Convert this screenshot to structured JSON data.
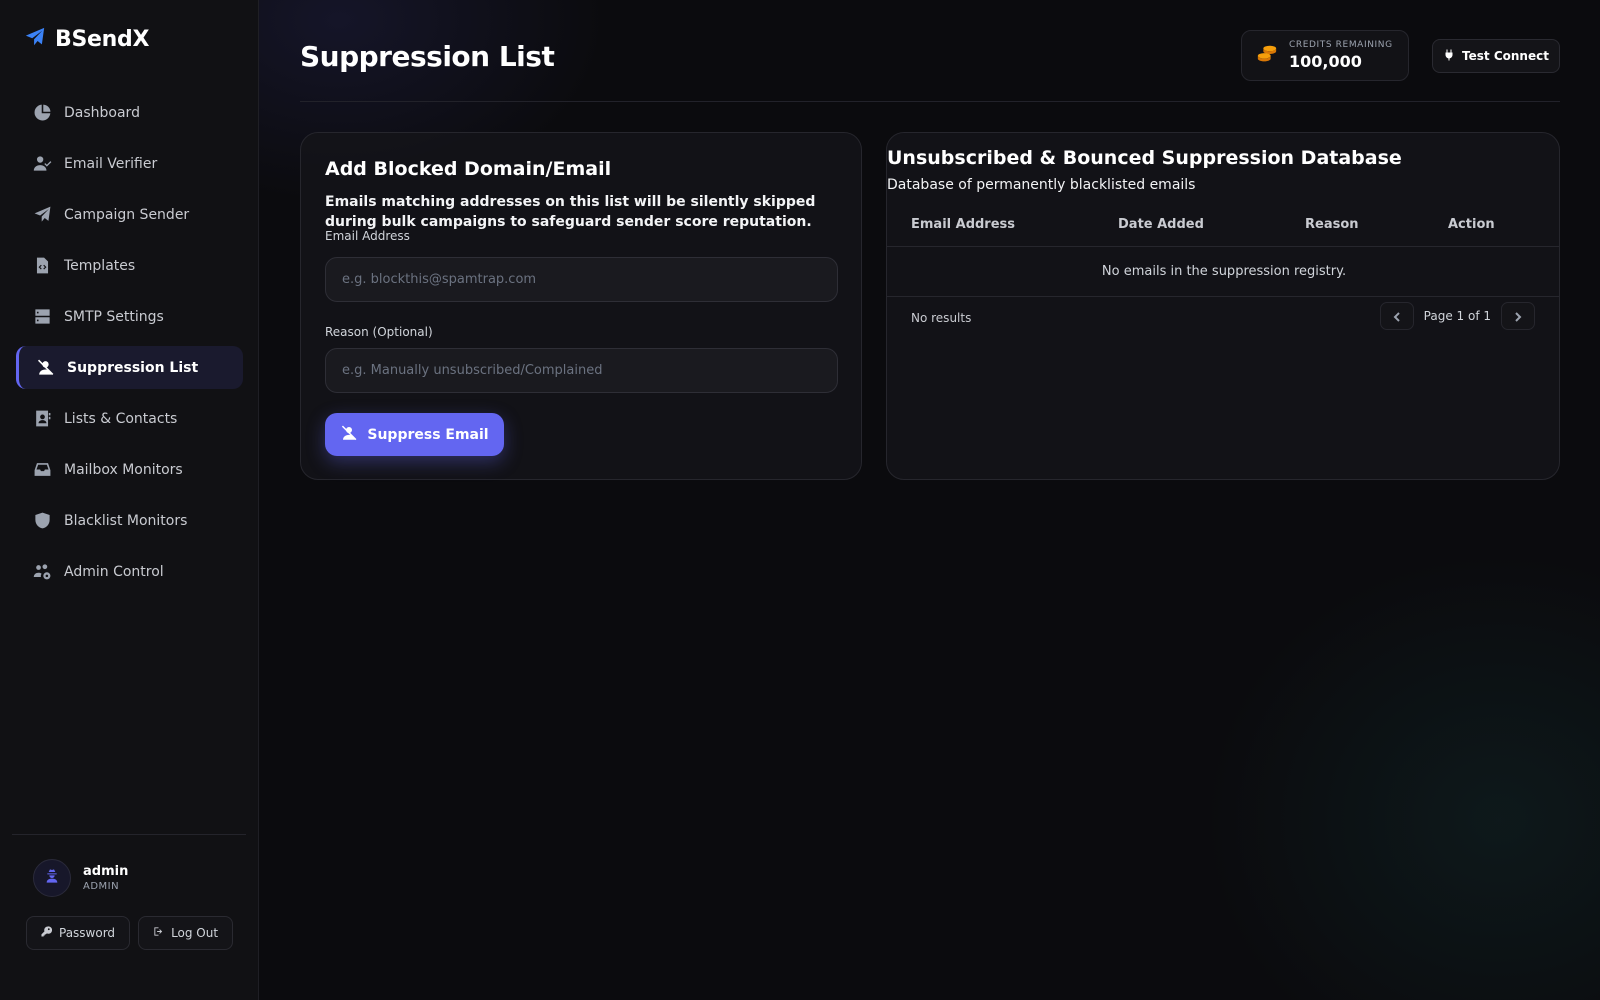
{
  "brand": {
    "name": "BSendX",
    "icon": "paper-plane-icon",
    "accent": "#3b82f6"
  },
  "sidebar": {
    "items": [
      {
        "label": "Dashboard",
        "icon": "pie-chart-icon",
        "active": false
      },
      {
        "label": "Email Verifier",
        "icon": "user-check-icon",
        "active": false
      },
      {
        "label": "Campaign Sender",
        "icon": "paper-plane-icon",
        "active": false
      },
      {
        "label": "Templates",
        "icon": "file-code-icon",
        "active": false
      },
      {
        "label": "SMTP Settings",
        "icon": "server-icon",
        "active": false
      },
      {
        "label": "Suppression List",
        "icon": "user-slash-icon",
        "active": true
      },
      {
        "label": "Lists & Contacts",
        "icon": "address-book-icon",
        "active": false
      },
      {
        "label": "Mailbox Monitors",
        "icon": "inbox-icon",
        "active": false
      },
      {
        "label": "Blacklist Monitors",
        "icon": "shield-icon",
        "active": false
      },
      {
        "label": "Admin Control",
        "icon": "users-cog-icon",
        "active": false
      }
    ],
    "user": {
      "name": "admin",
      "role": "ADMIN",
      "icon": "user-secret-icon"
    },
    "password_label": "Password",
    "logout_label": "Log Out"
  },
  "header": {
    "title": "Suppression List",
    "credits_label": "CREDITS REMAINING",
    "credits_value": "100,000",
    "credits_icon": "coins-icon",
    "test_connect_label": "Test Connect"
  },
  "add_form": {
    "title": "Add Blocked Domain/Email",
    "description": "Emails matching addresses on this list will be silently skipped during bulk campaigns to safeguard sender score reputation.",
    "email_label": "Email Address",
    "email_placeholder": "e.g. blockthis@spamtrap.com",
    "email_value": "",
    "reason_label": "Reason (Optional)",
    "reason_placeholder": "e.g. Manually unsubscribed/Complained",
    "reason_value": "",
    "submit_label": "Suppress Email"
  },
  "database": {
    "title": "Unsubscribed & Bounced Suppression Database",
    "subtitle": "Database of permanently blacklisted emails",
    "columns": [
      "Email Address",
      "Date Added",
      "Reason",
      "Action"
    ],
    "rows": [],
    "empty_message": "No emails in the suppression registry.",
    "results_text": "No results",
    "page_text": "Page 1 of 1"
  },
  "colors": {
    "primary": "#6366f1",
    "background": "#0b0b0e",
    "credits_coin": "#f59e0b"
  }
}
